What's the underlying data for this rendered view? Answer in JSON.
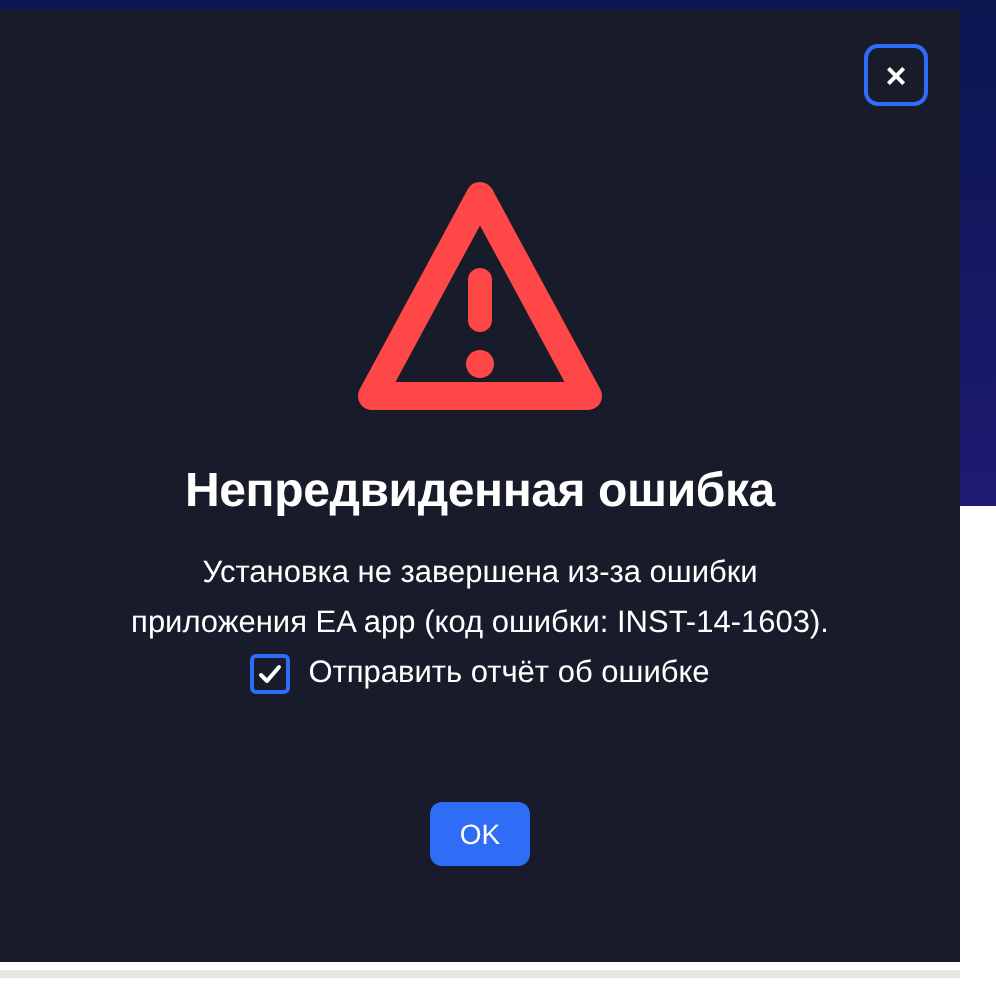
{
  "dialog": {
    "close_button": "×",
    "title": "Непредвиденная ошибка",
    "message": "Установка не завершена из-за ошибки приложения EA app (код ошибки: INST-14-1603).",
    "report_checkbox": {
      "label": "Отправить отчёт об ошибке",
      "checked": true
    },
    "buttons": [
      "OK"
    ]
  }
}
